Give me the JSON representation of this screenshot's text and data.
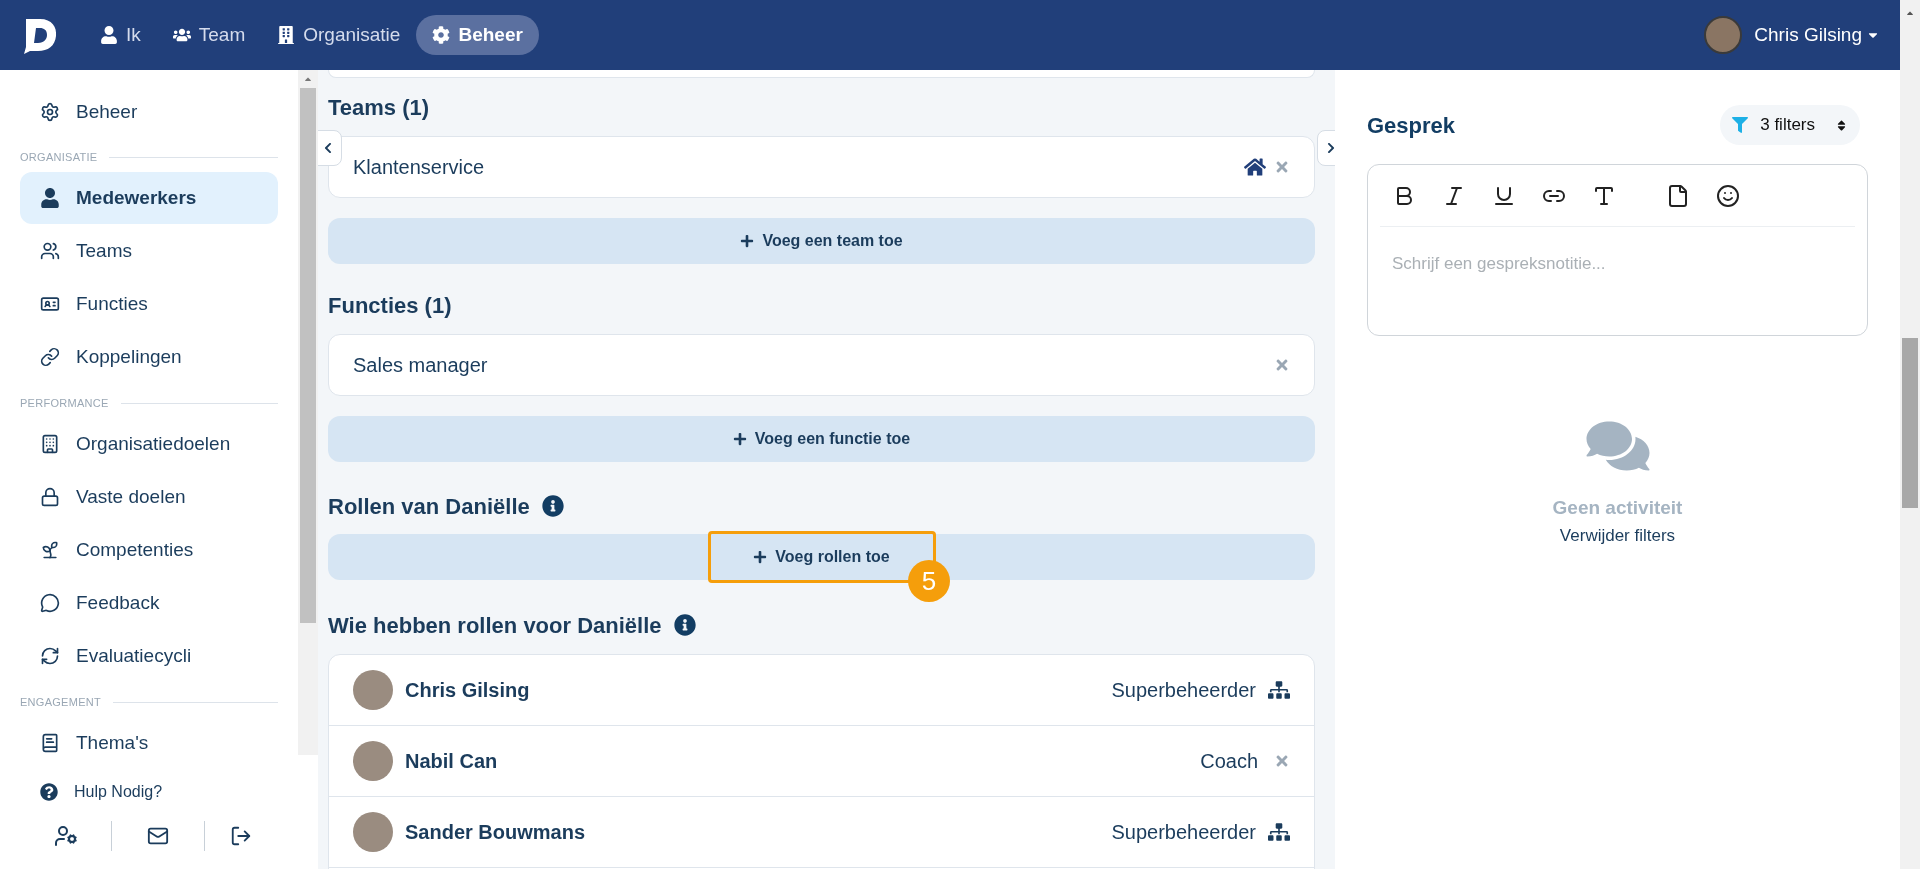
{
  "nav": {
    "items": [
      {
        "label": "Ik",
        "selected": false
      },
      {
        "label": "Team",
        "selected": false
      },
      {
        "label": "Organisatie",
        "selected": false
      },
      {
        "label": "Beheer",
        "selected": true
      }
    ],
    "user": {
      "name": "Chris Gilsing"
    }
  },
  "sidebar": {
    "top": {
      "label": "Beheer"
    },
    "sections": [
      {
        "label": "ORGANISATIE",
        "items": [
          {
            "label": "Medewerkers",
            "selected": true
          },
          {
            "label": "Teams",
            "selected": false
          },
          {
            "label": "Functies",
            "selected": false
          },
          {
            "label": "Koppelingen",
            "selected": false
          }
        ]
      },
      {
        "label": "PERFORMANCE",
        "items": [
          {
            "label": "Organisatiedoelen",
            "selected": false
          },
          {
            "label": "Vaste doelen",
            "selected": false
          },
          {
            "label": "Competenties",
            "selected": false
          },
          {
            "label": "Feedback",
            "selected": false
          },
          {
            "label": "Evaluatiecycli",
            "selected": false
          }
        ]
      },
      {
        "label": "ENGAGEMENT",
        "items": [
          {
            "label": "Thema's",
            "selected": false
          }
        ]
      }
    ],
    "help": "Hulp Nodig?"
  },
  "main": {
    "teams": {
      "title": "Teams (1)",
      "items": [
        {
          "name": "Klantenservice",
          "primary": true
        }
      ],
      "add": "Voeg een team toe"
    },
    "functies": {
      "title": "Functies (1)",
      "items": [
        {
          "name": "Sales manager",
          "primary": false
        }
      ],
      "add": "Voeg een functie toe"
    },
    "roles": {
      "title": "Rollen van Daniëlle",
      "add": "Voeg rollen toe",
      "highlight": true,
      "step_badge": "5"
    },
    "role_holders": {
      "title": "Wie hebben rollen voor Daniëlle",
      "rows": [
        {
          "name": "Chris Gilsing",
          "role": "Superbeheerder",
          "kind": "hierarchy"
        },
        {
          "name": "Nabil Can",
          "role": "Coach",
          "kind": "removable"
        },
        {
          "name": "Sander Bouwmans",
          "role": "Superbeheerder",
          "kind": "hierarchy"
        }
      ]
    }
  },
  "conversation": {
    "title": "Gesprek",
    "filter": "3 filters",
    "placeholder": "Schrijf een gespreksnotitie...",
    "empty_title": "Geen activiteit",
    "empty_action": "Verwijder filters"
  }
}
